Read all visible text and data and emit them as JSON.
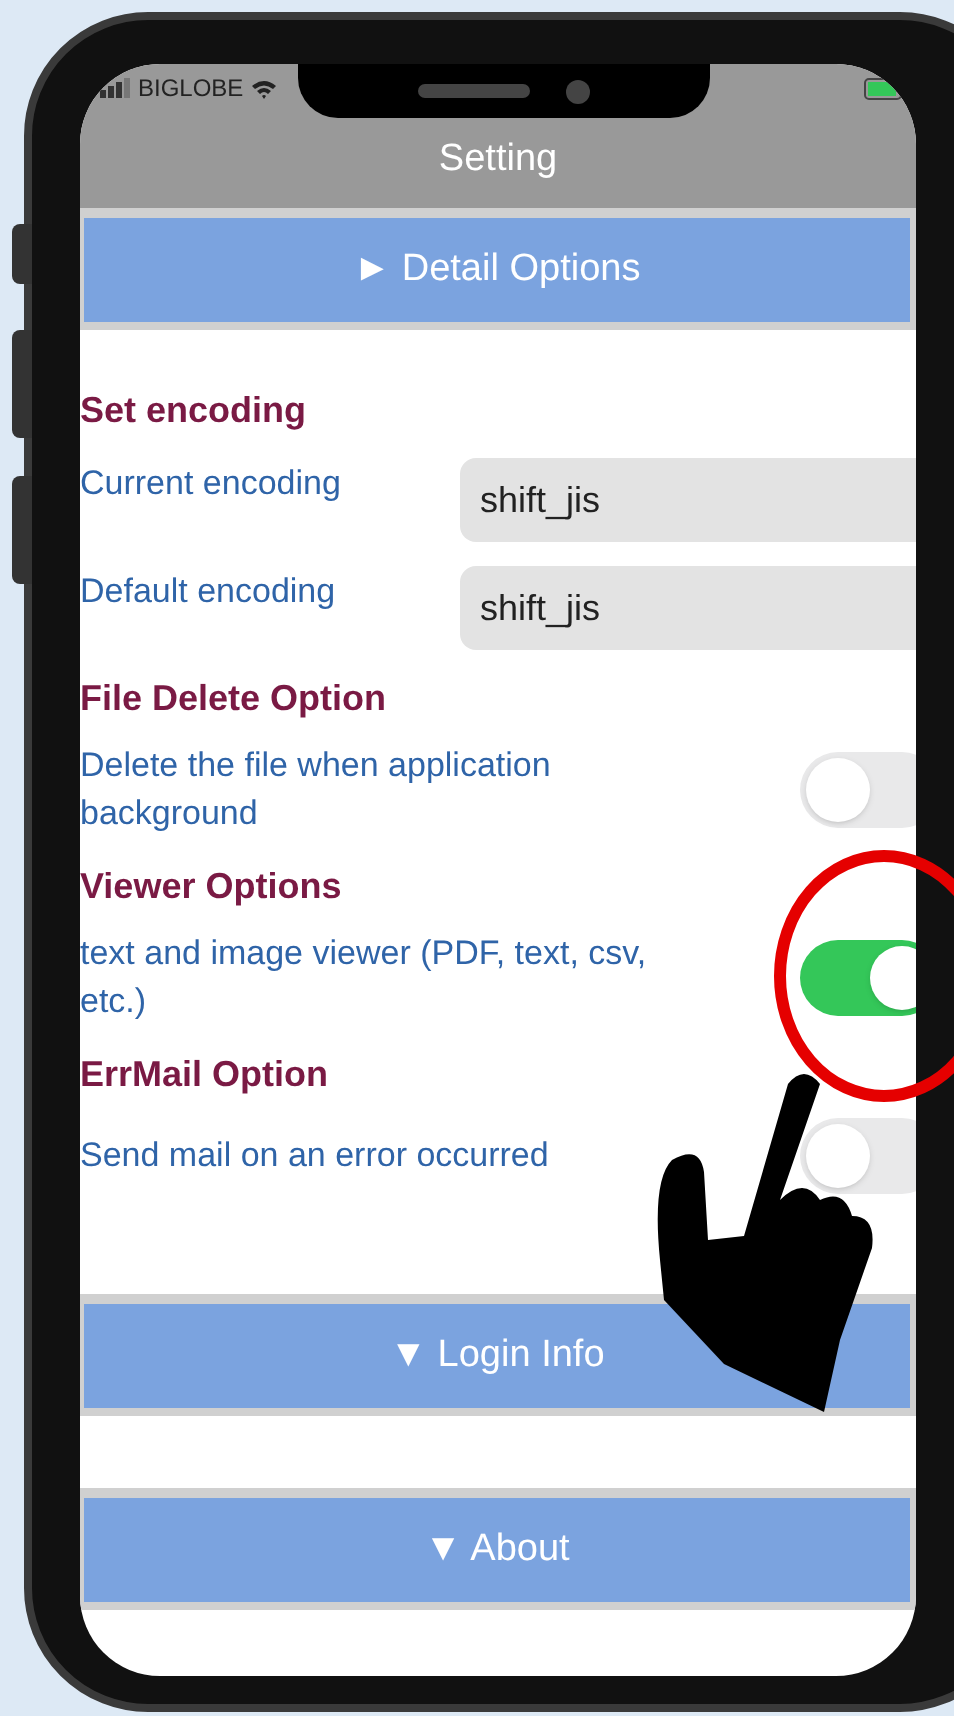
{
  "status_bar": {
    "carrier": "BIGLOBE"
  },
  "title": "Setting",
  "panels": [
    {
      "label": "► Detail Options",
      "groups": [
        {
          "heading": "Set encoding",
          "rows": [
            {
              "kind": "field",
              "label": "Current encoding",
              "value": "shift_jis"
            },
            {
              "kind": "field",
              "label": "Default encoding",
              "value": "shift_jis"
            }
          ]
        },
        {
          "heading": "File Delete Option",
          "rows": [
            {
              "kind": "toggle",
              "label": "Delete the file when application background",
              "on": false
            }
          ]
        },
        {
          "heading": "Viewer Options",
          "rows": [
            {
              "kind": "toggle",
              "label": "text and image viewer (PDF, text, csv, etc.)",
              "on": true
            }
          ]
        },
        {
          "heading": "ErrMail Option",
          "rows": [
            {
              "kind": "toggle",
              "label": "Send mail on an error occurred",
              "on": false
            }
          ]
        }
      ]
    },
    {
      "label": "▼ Login Info"
    },
    {
      "label": "▼ About"
    }
  ]
}
